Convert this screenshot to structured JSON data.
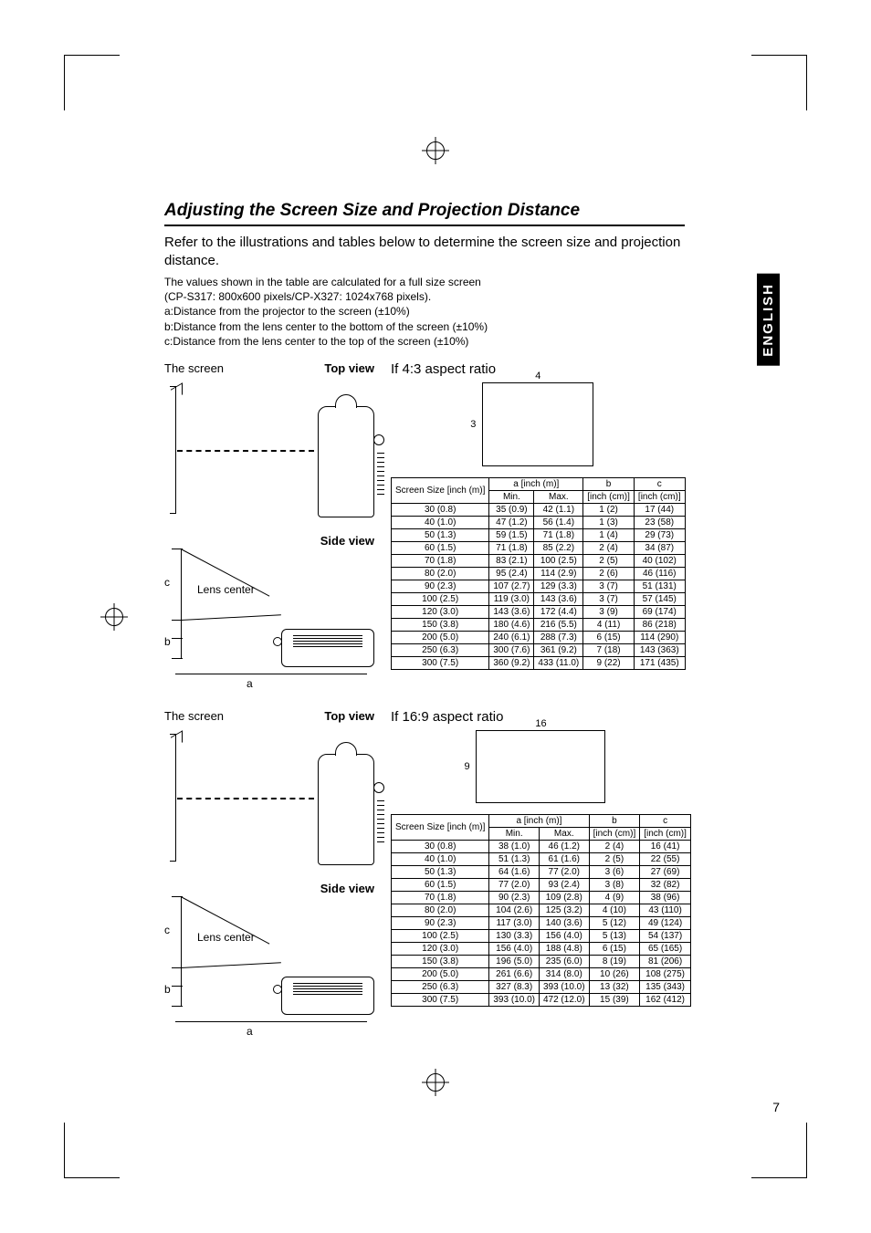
{
  "page_number": "7",
  "language_tab": "ENGLISH",
  "title": "Adjusting the Screen Size and Projection Distance",
  "intro": "Refer to the illustrations and tables below to determine the screen size and projection distance.",
  "notes": {
    "full": "The values shown in the table are calculated for a full size screen",
    "models": " (CP-S317: 800x600 pixels/CP-X327: 1024x768 pixels).",
    "a": "a:Distance from the projector to the screen (±10%)",
    "b": "b:Distance from the lens center to the bottom of the screen (±10%)",
    "c": "c:Distance from the lens center to the top of the screen (±10%)"
  },
  "labels": {
    "screen": "The screen",
    "top_view": "Top view",
    "side_view": "Side view",
    "lens_center": "Lens center",
    "a": "a",
    "b": "b",
    "c": "c"
  },
  "ratio43": {
    "title": "If 4:3 aspect ratio",
    "w": "4",
    "h": "3"
  },
  "ratio169": {
    "title": "If 16:9 aspect ratio",
    "w": "16",
    "h": "9"
  },
  "table_headers": {
    "size": "Screen Size [inch (m)]",
    "a": "a [inch (m)]",
    "min": "Min.",
    "max": "Max.",
    "b": "b",
    "c": "c",
    "unit": "[inch (cm)]"
  },
  "table43": [
    {
      "size": "30 (0.8)",
      "min": "35 (0.9)",
      "max": "42 (1.1)",
      "b": "1 (2)",
      "c": "17 (44)"
    },
    {
      "size": "40 (1.0)",
      "min": "47 (1.2)",
      "max": "56 (1.4)",
      "b": "1 (3)",
      "c": "23 (58)"
    },
    {
      "size": "50 (1.3)",
      "min": "59 (1.5)",
      "max": "71 (1.8)",
      "b": "1 (4)",
      "c": "29 (73)"
    },
    {
      "size": "60 (1.5)",
      "min": "71 (1.8)",
      "max": "85 (2.2)",
      "b": "2 (4)",
      "c": "34 (87)"
    },
    {
      "size": "70 (1.8)",
      "min": "83 (2.1)",
      "max": "100 (2.5)",
      "b": "2 (5)",
      "c": "40 (102)"
    },
    {
      "size": "80 (2.0)",
      "min": "95 (2.4)",
      "max": "114 (2.9)",
      "b": "2 (6)",
      "c": "46 (116)"
    },
    {
      "size": "90 (2.3)",
      "min": "107 (2.7)",
      "max": "129 (3.3)",
      "b": "3 (7)",
      "c": "51 (131)"
    },
    {
      "size": "100 (2.5)",
      "min": "119 (3.0)",
      "max": "143 (3.6)",
      "b": "3 (7)",
      "c": "57 (145)"
    },
    {
      "size": "120 (3.0)",
      "min": "143 (3.6)",
      "max": "172 (4.4)",
      "b": "3 (9)",
      "c": "69 (174)"
    },
    {
      "size": "150 (3.8)",
      "min": "180 (4.6)",
      "max": "216 (5.5)",
      "b": "4 (11)",
      "c": "86 (218)"
    },
    {
      "size": "200 (5.0)",
      "min": "240 (6.1)",
      "max": "288 (7.3)",
      "b": "6 (15)",
      "c": "114 (290)"
    },
    {
      "size": "250 (6.3)",
      "min": "300 (7.6)",
      "max": "361 (9.2)",
      "b": "7 (18)",
      "c": "143 (363)"
    },
    {
      "size": "300 (7.5)",
      "min": "360 (9.2)",
      "max": "433 (11.0)",
      "b": "9 (22)",
      "c": "171 (435)"
    }
  ],
  "table169": [
    {
      "size": "30 (0.8)",
      "min": "38 (1.0)",
      "max": "46 (1.2)",
      "b": "2 (4)",
      "c": "16 (41)"
    },
    {
      "size": "40 (1.0)",
      "min": "51 (1.3)",
      "max": "61 (1.6)",
      "b": "2 (5)",
      "c": "22 (55)"
    },
    {
      "size": "50 (1.3)",
      "min": "64 (1.6)",
      "max": "77 (2.0)",
      "b": "3 (6)",
      "c": "27 (69)"
    },
    {
      "size": "60 (1.5)",
      "min": "77 (2.0)",
      "max": "93 (2.4)",
      "b": "3 (8)",
      "c": "32 (82)"
    },
    {
      "size": "70 (1.8)",
      "min": "90 (2.3)",
      "max": "109 (2.8)",
      "b": "4 (9)",
      "c": "38 (96)"
    },
    {
      "size": "80 (2.0)",
      "min": "104 (2.6)",
      "max": "125 (3.2)",
      "b": "4 (10)",
      "c": "43 (110)"
    },
    {
      "size": "90 (2.3)",
      "min": "117 (3.0)",
      "max": "140 (3.6)",
      "b": "5 (12)",
      "c": "49 (124)"
    },
    {
      "size": "100 (2.5)",
      "min": "130 (3.3)",
      "max": "156 (4.0)",
      "b": "5 (13)",
      "c": "54 (137)"
    },
    {
      "size": "120 (3.0)",
      "min": "156 (4.0)",
      "max": "188 (4.8)",
      "b": "6 (15)",
      "c": "65 (165)"
    },
    {
      "size": "150 (3.8)",
      "min": "196 (5.0)",
      "max": "235 (6.0)",
      "b": "8 (19)",
      "c": "81 (206)"
    },
    {
      "size": "200 (5.0)",
      "min": "261 (6.6)",
      "max": "314 (8.0)",
      "b": "10 (26)",
      "c": "108 (275)"
    },
    {
      "size": "250 (6.3)",
      "min": "327 (8.3)",
      "max": "393 (10.0)",
      "b": "13 (32)",
      "c": "135 (343)"
    },
    {
      "size": "300 (7.5)",
      "min": "393 (10.0)",
      "max": "472 (12.0)",
      "b": "15 (39)",
      "c": "162 (412)"
    }
  ]
}
